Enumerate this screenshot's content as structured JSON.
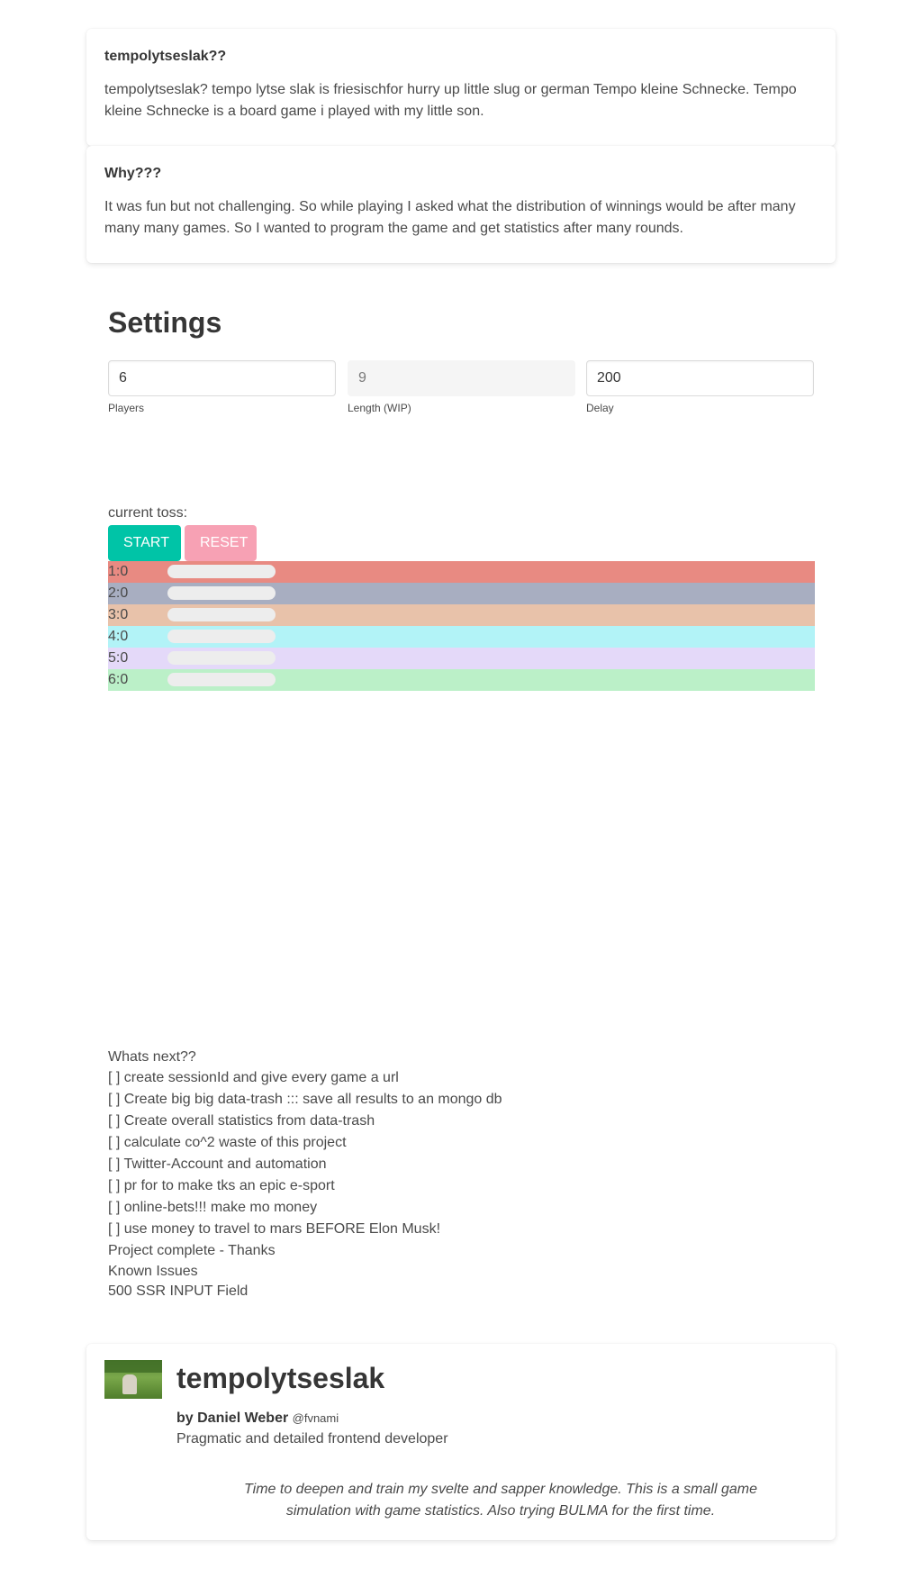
{
  "faq": [
    {
      "title": "tempolytseslak??",
      "body": "tempolytseslak? tempo lytse slak is friesischfor hurry up little slug or german Tempo kleine Schnecke. Tempo kleine Schnecke is a board game i played with my little son."
    },
    {
      "title": "Why???",
      "body": "It was fun but not challenging. So while playing I asked what the distribution of winnings would be after many many many games. So I wanted to program the game and get statistics after many rounds."
    }
  ],
  "settings": {
    "title": "Settings",
    "players": {
      "value": "6",
      "help": "Players"
    },
    "length": {
      "value": "9",
      "help": "Length (WIP)"
    },
    "delay": {
      "value": "200",
      "help": "Delay"
    }
  },
  "game": {
    "toss_label": "current toss:",
    "start_label": "START",
    "reset_label": "RESET",
    "players": [
      {
        "label": "1:0",
        "color": "#e88a82",
        "progress": 0
      },
      {
        "label": "2:0",
        "color": "#a8aec1",
        "progress": 0
      },
      {
        "label": "3:0",
        "color": "#e8c2aa",
        "progress": 0
      },
      {
        "label": "4:0",
        "color": "#b2f3f7",
        "progress": 0
      },
      {
        "label": "5:0",
        "color": "#e4d9f9",
        "progress": 0
      },
      {
        "label": "6:0",
        "color": "#bbf0c8",
        "progress": 0
      }
    ]
  },
  "next": {
    "title": "Whats next??",
    "items": [
      "[ ] create sessionId and give every game a url",
      "[ ] Create big big data-trash ::: save all results to an mongo db",
      "[ ] Create overall statistics from data-trash",
      "[ ] calculate co^2 waste of this project",
      "[ ] Twitter-Account and automation",
      "[ ] pr for to make tks an epic e-sport",
      "[ ] online-bets!!! make mo money",
      "[ ] use money to travel to mars BEFORE Elon Musk!"
    ],
    "complete": "Project complete - Thanks",
    "known_issues": "Known Issues",
    "issue": "500 SSR INPUT Field"
  },
  "footer": {
    "title": "tempolytseslak",
    "by": "by Daniel Weber",
    "handle": "@fvnami",
    "subtitle": "Pragmatic and detailed frontend developer",
    "quote": "Time to deepen and train my svelte and sapper knowledge. This is a small game simulation with game statistics. Also trying BULMA for the first time."
  }
}
